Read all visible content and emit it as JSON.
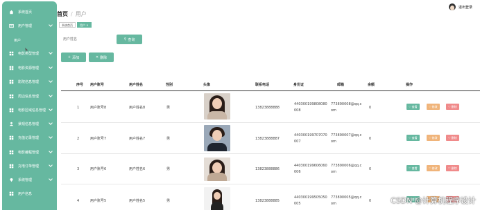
{
  "sidebar": {
    "items": [
      {
        "label": "系统首页",
        "icon": "home-icon",
        "has_chevron": false
      },
      {
        "label": "用户管理",
        "icon": "user-icon",
        "has_chevron": true
      },
      {
        "label": "电影类型管理",
        "icon": "grid-icon",
        "has_chevron": true
      },
      {
        "label": "电影资源管理",
        "icon": "grid-icon",
        "has_chevron": true
      },
      {
        "label": "影院信息管理",
        "icon": "grid-icon",
        "has_chevron": true
      },
      {
        "label": "周边信息管理",
        "icon": "grid-icon",
        "has_chevron": true
      },
      {
        "label": "电影区域信息管理",
        "icon": "grid-icon",
        "has_chevron": true
      },
      {
        "label": "景观信息管理",
        "icon": "person-icon",
        "has_chevron": true
      },
      {
        "label": "充值记录管理",
        "icon": "grid-icon",
        "has_chevron": true
      },
      {
        "label": "电影编程管理",
        "icon": "grid-icon",
        "has_chevron": true
      },
      {
        "label": "充电订单管理",
        "icon": "grid-icon",
        "has_chevron": true
      },
      {
        "label": "系统管理",
        "icon": "pin-icon",
        "has_chevron": true
      },
      {
        "label": "用户信息",
        "icon": "grid-icon",
        "has_chevron": false
      }
    ],
    "sub_item": "用户"
  },
  "header": {
    "breadcrumb_home": "首页",
    "breadcrumb_sep": "/",
    "breadcrumb_current": "用户",
    "user_label": "退出登录"
  },
  "tags": [
    "系统首页",
    "用户 ×"
  ],
  "search": {
    "placeholder": "用户姓名",
    "button": "查询"
  },
  "actions": {
    "add": "添加",
    "delete": "删除"
  },
  "table": {
    "columns": [
      "序号",
      "用户账号",
      "用户姓名",
      "性别",
      "头像",
      "联系电话",
      "身份证",
      "邮箱",
      "余额",
      "操作"
    ],
    "rows": [
      {
        "index": "1",
        "account": "用户账号8",
        "name": "用户姓名8",
        "gender": "男",
        "phone": "13823888888",
        "id_line1": "440300199808080",
        "id_line2": "008",
        "email_line1": "773890008@qq.c",
        "email_line2": "om",
        "balance": "0",
        "photo": "woman"
      },
      {
        "index": "2",
        "account": "用户账号7",
        "name": "用户姓名7",
        "gender": "男",
        "phone": "13823888887",
        "id_line1": "440300199707070",
        "id_line2": "007",
        "email_line1": "773890007@qq.c",
        "email_line2": "om",
        "balance": "0",
        "photo": "man"
      },
      {
        "index": "3",
        "account": "用户账号6",
        "name": "用户姓名6",
        "gender": "男",
        "phone": "13823888886",
        "id_line1": "440300199606060",
        "id_line2": "006",
        "email_line1": "773890006@qq.c",
        "email_line2": "om",
        "balance": "0",
        "photo": "woman"
      },
      {
        "index": "4",
        "account": "用户账号5",
        "name": "用户姓名5",
        "gender": "男",
        "phone": "13823888885",
        "id_line1": "440300199505050",
        "id_line2": "005",
        "email_line1": "773890005@qq.c",
        "email_line2": "om",
        "balance": "0",
        "photo": "woman2"
      }
    ],
    "ops": {
      "view": "查看",
      "edit": "修改",
      "delete": "删除"
    }
  },
  "watermark": "CSDN @计算机程序设计",
  "colors": {
    "accent": "#66b8a0",
    "edit": "#f0b47a",
    "delete": "#f08a8a"
  }
}
